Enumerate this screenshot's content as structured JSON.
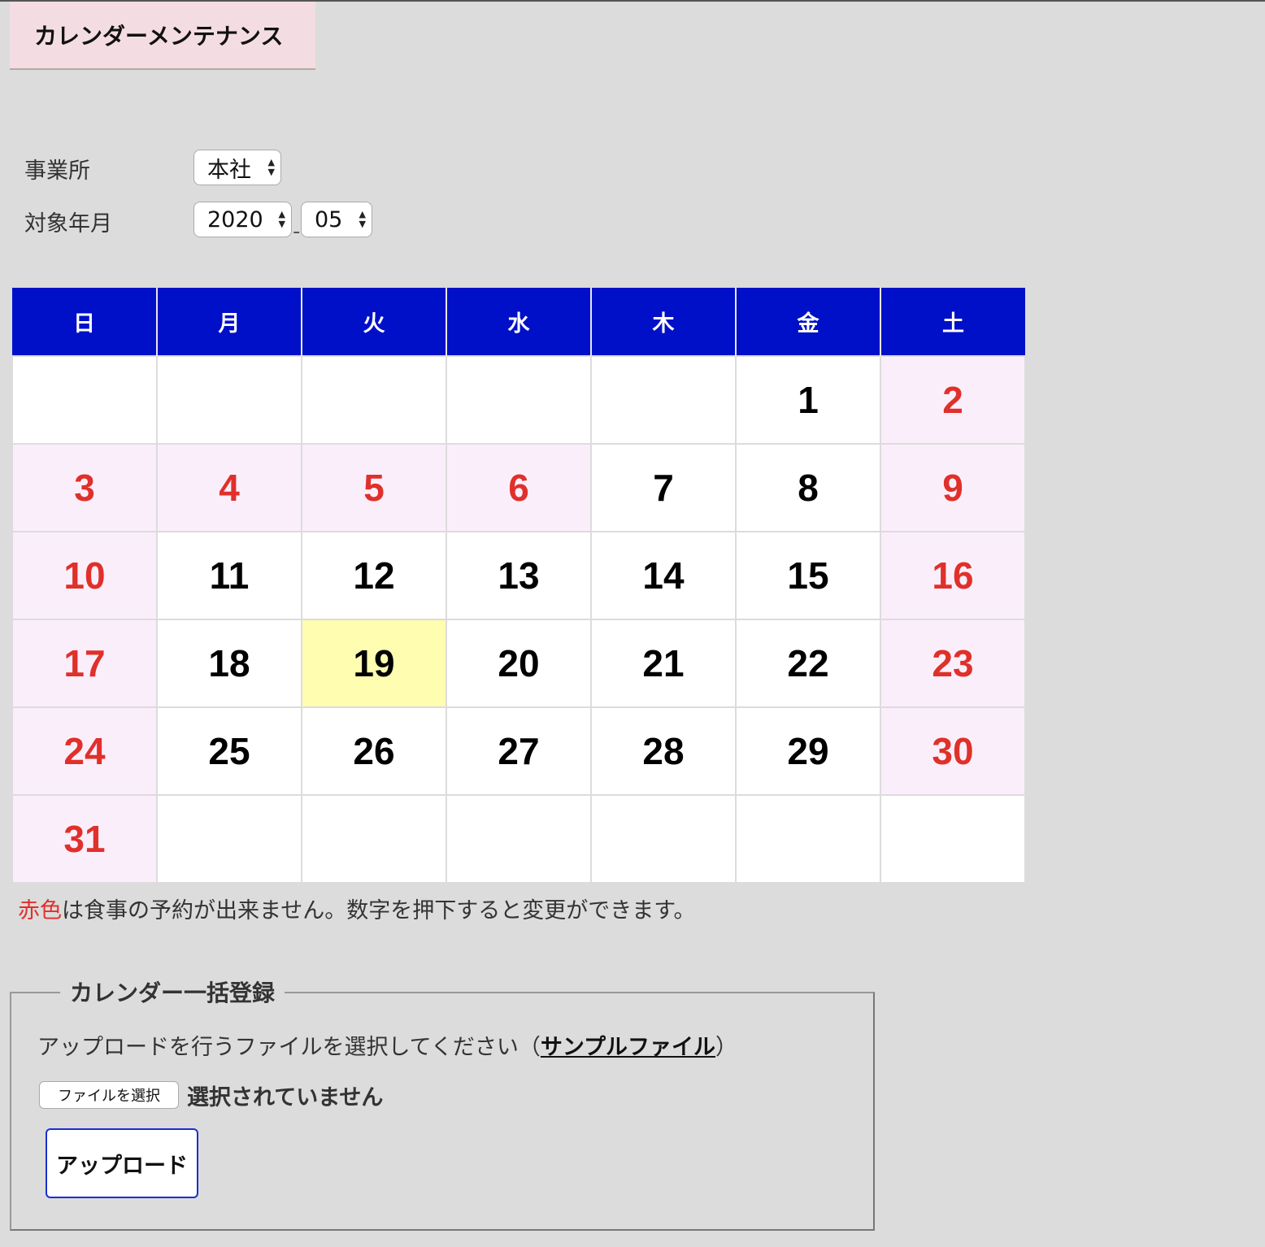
{
  "page": {
    "title": "カレンダーメンテナンス"
  },
  "filters": {
    "office_label": "事業所",
    "office_value": "本社",
    "period_label": "対象年月",
    "year_value": "2020",
    "separator": "-",
    "month_value": "05"
  },
  "calendar": {
    "weekdays": [
      "日",
      "月",
      "火",
      "水",
      "木",
      "金",
      "土"
    ],
    "weeks": [
      [
        {
          "d": ""
        },
        {
          "d": ""
        },
        {
          "d": ""
        },
        {
          "d": ""
        },
        {
          "d": ""
        },
        {
          "d": "1"
        },
        {
          "d": "2",
          "red": true
        }
      ],
      [
        {
          "d": "3",
          "red": true
        },
        {
          "d": "4",
          "red": true
        },
        {
          "d": "5",
          "red": true
        },
        {
          "d": "6",
          "red": true
        },
        {
          "d": "7"
        },
        {
          "d": "8"
        },
        {
          "d": "9",
          "red": true
        }
      ],
      [
        {
          "d": "10",
          "red": true
        },
        {
          "d": "11"
        },
        {
          "d": "12"
        },
        {
          "d": "13"
        },
        {
          "d": "14"
        },
        {
          "d": "15"
        },
        {
          "d": "16",
          "red": true
        }
      ],
      [
        {
          "d": "17",
          "red": true
        },
        {
          "d": "18"
        },
        {
          "d": "19",
          "today": true
        },
        {
          "d": "20"
        },
        {
          "d": "21"
        },
        {
          "d": "22"
        },
        {
          "d": "23",
          "red": true
        }
      ],
      [
        {
          "d": "24",
          "red": true
        },
        {
          "d": "25"
        },
        {
          "d": "26"
        },
        {
          "d": "27"
        },
        {
          "d": "28"
        },
        {
          "d": "29"
        },
        {
          "d": "30",
          "red": true
        }
      ],
      [
        {
          "d": "31",
          "red": true
        },
        {
          "d": ""
        },
        {
          "d": ""
        },
        {
          "d": ""
        },
        {
          "d": ""
        },
        {
          "d": ""
        },
        {
          "d": ""
        }
      ]
    ],
    "holiday_color": "#e0302a",
    "holiday_bg": "#fbeefb",
    "today_bg": "#fefdb0",
    "header_bg": "#0010c8"
  },
  "note": {
    "red_word": "赤色",
    "text": "は食事の予約が出来ません。数字を押下すると変更ができます。"
  },
  "bulk": {
    "legend": "カレンダー一括登録",
    "instruction_prefix": "アップロードを行うファイルを選択してください（",
    "sample_link": "サンプルファイル",
    "instruction_suffix": "）",
    "file_button": "ファイルを選択",
    "file_status": "選択されていません",
    "upload_button": "アップロード"
  }
}
